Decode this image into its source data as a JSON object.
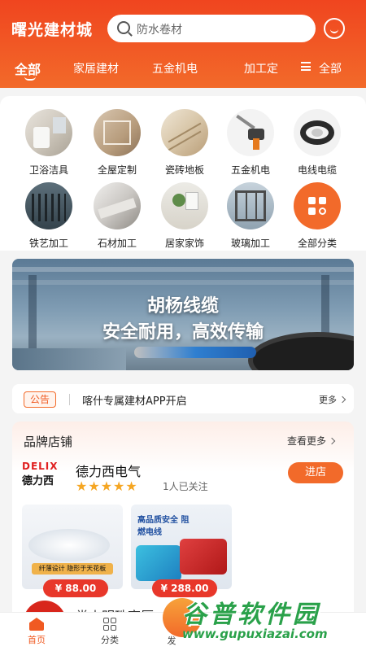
{
  "header": {
    "app_title": "曙光建材城",
    "search_placeholder": "防水卷材",
    "tabs": [
      "全部",
      "家居建材",
      "五金机电",
      "加工定",
      "全部"
    ]
  },
  "categories": [
    {
      "label": "卫浴洁具",
      "icon": "bathroom-icon"
    },
    {
      "label": "全屋定制",
      "icon": "custom-furniture-icon"
    },
    {
      "label": "瓷砖地板",
      "icon": "tile-icon"
    },
    {
      "label": "五金机电",
      "icon": "hardware-tools-icon"
    },
    {
      "label": "电线电缆",
      "icon": "cable-icon"
    },
    {
      "label": "铁艺加工",
      "icon": "ironwork-icon"
    },
    {
      "label": "石材加工",
      "icon": "stone-icon"
    },
    {
      "label": "居家家饰",
      "icon": "home-decor-icon"
    },
    {
      "label": "玻璃加工",
      "icon": "glass-icon"
    },
    {
      "label": "全部分类",
      "icon": "all-categories-icon"
    }
  ],
  "banner": {
    "line1": "胡杨线缆",
    "line2": "安全耐用，高效传输"
  },
  "notice": {
    "tag": "公告",
    "text": "喀什专属建材APP开启",
    "more": "更多"
  },
  "brand": {
    "section_title": "品牌店铺",
    "more": "查看更多",
    "store": {
      "logo_top": "DELIX",
      "logo_bottom": "德力西",
      "name": "德力西电气",
      "rating": 5,
      "stars": "★★★★★",
      "followers": "1人已关注",
      "enter": "进店"
    },
    "products": [
      {
        "price": "¥ 88.00",
        "caption": "纤薄设计 隐形于天花板"
      },
      {
        "price": "¥ 288.00",
        "caption": "高品质安全 阻燃电线"
      }
    ],
    "next_store_name": "常山明珠商厦"
  },
  "bottom_nav": [
    {
      "label": "首页",
      "active": true
    },
    {
      "label": "分类",
      "active": false
    },
    {
      "label": "发",
      "active": false
    }
  ],
  "watermark": {
    "line1": "谷普软件园",
    "line2": "www.gupuxiazai.com"
  },
  "colors": {
    "brand": "#f05a22",
    "header_gradient_end": "#f26a2a",
    "price": "#e8372a",
    "star": "#f5a623"
  }
}
